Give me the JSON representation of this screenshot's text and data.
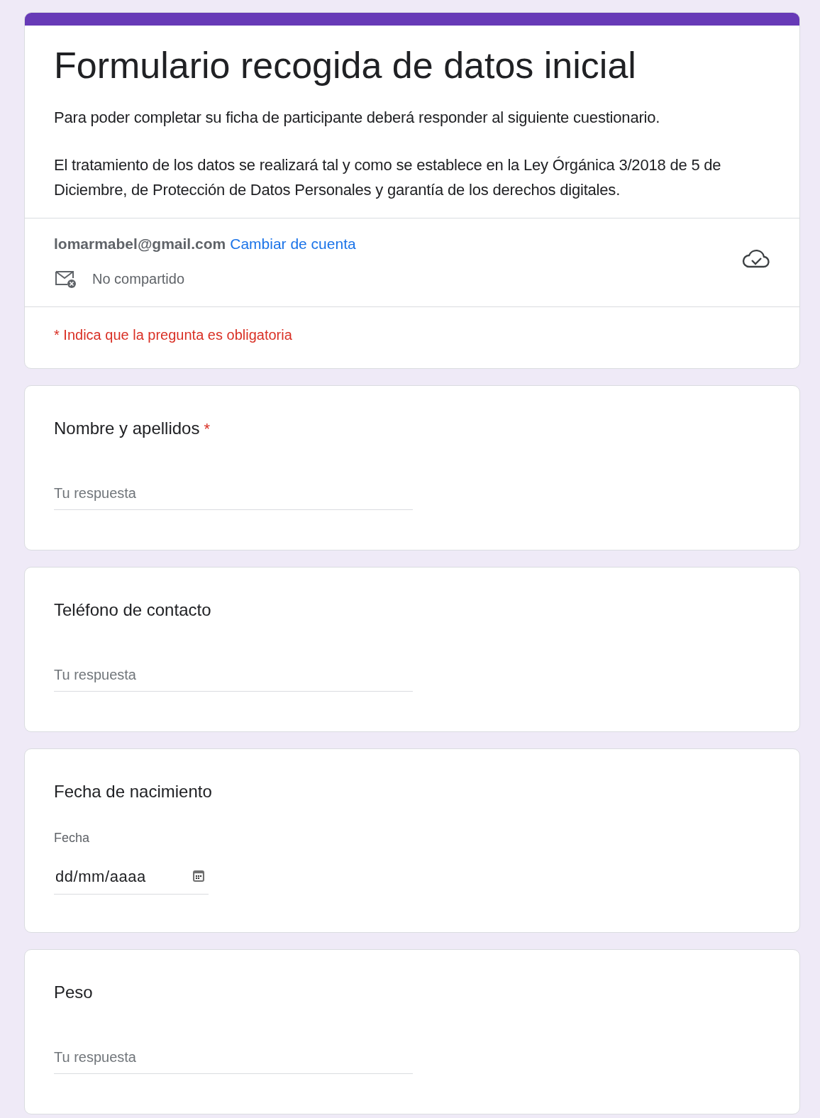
{
  "header": {
    "title": "Formulario recogida de datos inicial",
    "description": [
      "Para poder completar su ficha de participante deberá responder al siguiente cuestionario.",
      "El tratamiento de los datos se realizará tal y como se establece en la Ley Órgánica 3/2018 de 5 de Diciembre, de Protección de Datos Personales y garantía de los derechos digitales."
    ],
    "account": {
      "email": "lomarmabel@gmail.com",
      "switch_link": "Cambiar de cuenta",
      "sharing": "No compartido"
    },
    "required_note": "* Indica que la pregunta es obligatoria"
  },
  "questions": [
    {
      "kind": "text",
      "title": "Nombre y apellidos",
      "required_mark": "*",
      "placeholder": "Tu respuesta"
    },
    {
      "kind": "text",
      "title": "Teléfono de contacto",
      "placeholder": "Tu respuesta"
    },
    {
      "kind": "date",
      "title": "Fecha de nacimiento",
      "field_label": "Fecha",
      "value": "dd/mm/aaaa"
    },
    {
      "kind": "text",
      "title": "Peso",
      "placeholder": "Tu respuesta"
    }
  ]
}
